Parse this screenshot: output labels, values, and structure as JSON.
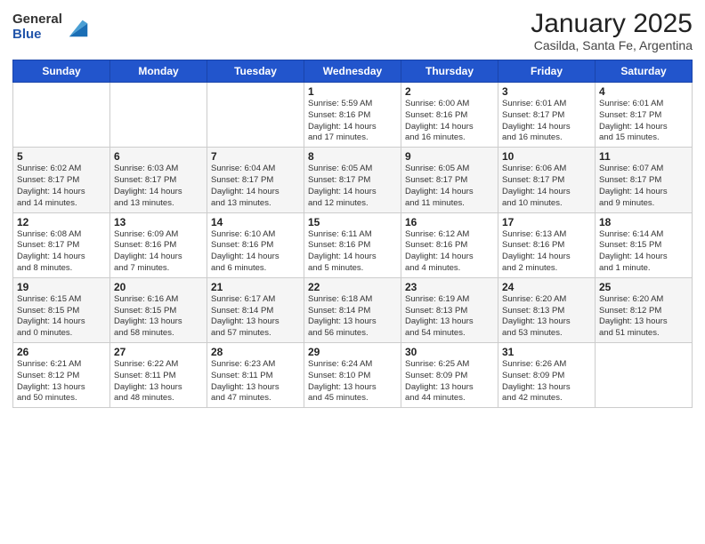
{
  "header": {
    "logo_general": "General",
    "logo_blue": "Blue",
    "title": "January 2025",
    "subtitle": "Casilda, Santa Fe, Argentina"
  },
  "weekdays": [
    "Sunday",
    "Monday",
    "Tuesday",
    "Wednesday",
    "Thursday",
    "Friday",
    "Saturday"
  ],
  "weeks": [
    [
      {
        "day": "",
        "info": ""
      },
      {
        "day": "",
        "info": ""
      },
      {
        "day": "",
        "info": ""
      },
      {
        "day": "1",
        "info": "Sunrise: 5:59 AM\nSunset: 8:16 PM\nDaylight: 14 hours\nand 17 minutes."
      },
      {
        "day": "2",
        "info": "Sunrise: 6:00 AM\nSunset: 8:16 PM\nDaylight: 14 hours\nand 16 minutes."
      },
      {
        "day": "3",
        "info": "Sunrise: 6:01 AM\nSunset: 8:17 PM\nDaylight: 14 hours\nand 16 minutes."
      },
      {
        "day": "4",
        "info": "Sunrise: 6:01 AM\nSunset: 8:17 PM\nDaylight: 14 hours\nand 15 minutes."
      }
    ],
    [
      {
        "day": "5",
        "info": "Sunrise: 6:02 AM\nSunset: 8:17 PM\nDaylight: 14 hours\nand 14 minutes."
      },
      {
        "day": "6",
        "info": "Sunrise: 6:03 AM\nSunset: 8:17 PM\nDaylight: 14 hours\nand 13 minutes."
      },
      {
        "day": "7",
        "info": "Sunrise: 6:04 AM\nSunset: 8:17 PM\nDaylight: 14 hours\nand 13 minutes."
      },
      {
        "day": "8",
        "info": "Sunrise: 6:05 AM\nSunset: 8:17 PM\nDaylight: 14 hours\nand 12 minutes."
      },
      {
        "day": "9",
        "info": "Sunrise: 6:05 AM\nSunset: 8:17 PM\nDaylight: 14 hours\nand 11 minutes."
      },
      {
        "day": "10",
        "info": "Sunrise: 6:06 AM\nSunset: 8:17 PM\nDaylight: 14 hours\nand 10 minutes."
      },
      {
        "day": "11",
        "info": "Sunrise: 6:07 AM\nSunset: 8:17 PM\nDaylight: 14 hours\nand 9 minutes."
      }
    ],
    [
      {
        "day": "12",
        "info": "Sunrise: 6:08 AM\nSunset: 8:17 PM\nDaylight: 14 hours\nand 8 minutes."
      },
      {
        "day": "13",
        "info": "Sunrise: 6:09 AM\nSunset: 8:16 PM\nDaylight: 14 hours\nand 7 minutes."
      },
      {
        "day": "14",
        "info": "Sunrise: 6:10 AM\nSunset: 8:16 PM\nDaylight: 14 hours\nand 6 minutes."
      },
      {
        "day": "15",
        "info": "Sunrise: 6:11 AM\nSunset: 8:16 PM\nDaylight: 14 hours\nand 5 minutes."
      },
      {
        "day": "16",
        "info": "Sunrise: 6:12 AM\nSunset: 8:16 PM\nDaylight: 14 hours\nand 4 minutes."
      },
      {
        "day": "17",
        "info": "Sunrise: 6:13 AM\nSunset: 8:16 PM\nDaylight: 14 hours\nand 2 minutes."
      },
      {
        "day": "18",
        "info": "Sunrise: 6:14 AM\nSunset: 8:15 PM\nDaylight: 14 hours\nand 1 minute."
      }
    ],
    [
      {
        "day": "19",
        "info": "Sunrise: 6:15 AM\nSunset: 8:15 PM\nDaylight: 14 hours\nand 0 minutes."
      },
      {
        "day": "20",
        "info": "Sunrise: 6:16 AM\nSunset: 8:15 PM\nDaylight: 13 hours\nand 58 minutes."
      },
      {
        "day": "21",
        "info": "Sunrise: 6:17 AM\nSunset: 8:14 PM\nDaylight: 13 hours\nand 57 minutes."
      },
      {
        "day": "22",
        "info": "Sunrise: 6:18 AM\nSunset: 8:14 PM\nDaylight: 13 hours\nand 56 minutes."
      },
      {
        "day": "23",
        "info": "Sunrise: 6:19 AM\nSunset: 8:13 PM\nDaylight: 13 hours\nand 54 minutes."
      },
      {
        "day": "24",
        "info": "Sunrise: 6:20 AM\nSunset: 8:13 PM\nDaylight: 13 hours\nand 53 minutes."
      },
      {
        "day": "25",
        "info": "Sunrise: 6:20 AM\nSunset: 8:12 PM\nDaylight: 13 hours\nand 51 minutes."
      }
    ],
    [
      {
        "day": "26",
        "info": "Sunrise: 6:21 AM\nSunset: 8:12 PM\nDaylight: 13 hours\nand 50 minutes."
      },
      {
        "day": "27",
        "info": "Sunrise: 6:22 AM\nSunset: 8:11 PM\nDaylight: 13 hours\nand 48 minutes."
      },
      {
        "day": "28",
        "info": "Sunrise: 6:23 AM\nSunset: 8:11 PM\nDaylight: 13 hours\nand 47 minutes."
      },
      {
        "day": "29",
        "info": "Sunrise: 6:24 AM\nSunset: 8:10 PM\nDaylight: 13 hours\nand 45 minutes."
      },
      {
        "day": "30",
        "info": "Sunrise: 6:25 AM\nSunset: 8:09 PM\nDaylight: 13 hours\nand 44 minutes."
      },
      {
        "day": "31",
        "info": "Sunrise: 6:26 AM\nSunset: 8:09 PM\nDaylight: 13 hours\nand 42 minutes."
      },
      {
        "day": "",
        "info": ""
      }
    ]
  ]
}
